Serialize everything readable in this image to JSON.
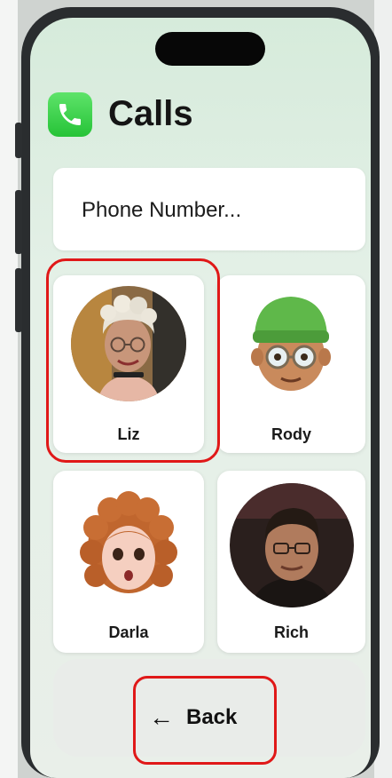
{
  "app": {
    "title": "Calls",
    "icon": "phone-icon",
    "accent": "#34c759"
  },
  "phone_input": {
    "placeholder": "Phone Number..."
  },
  "contacts": [
    {
      "name": "Liz",
      "avatar": "liz-photo",
      "selected": true
    },
    {
      "name": "Rody",
      "avatar": "rody-memoji",
      "selected": false
    },
    {
      "name": "Darla",
      "avatar": "darla-memoji",
      "selected": false
    },
    {
      "name": "Rich",
      "avatar": "rich-photo",
      "selected": false
    }
  ],
  "back_button": {
    "label": "Back",
    "icon": "arrow-left-icon"
  },
  "annotation_color": "#e01818"
}
